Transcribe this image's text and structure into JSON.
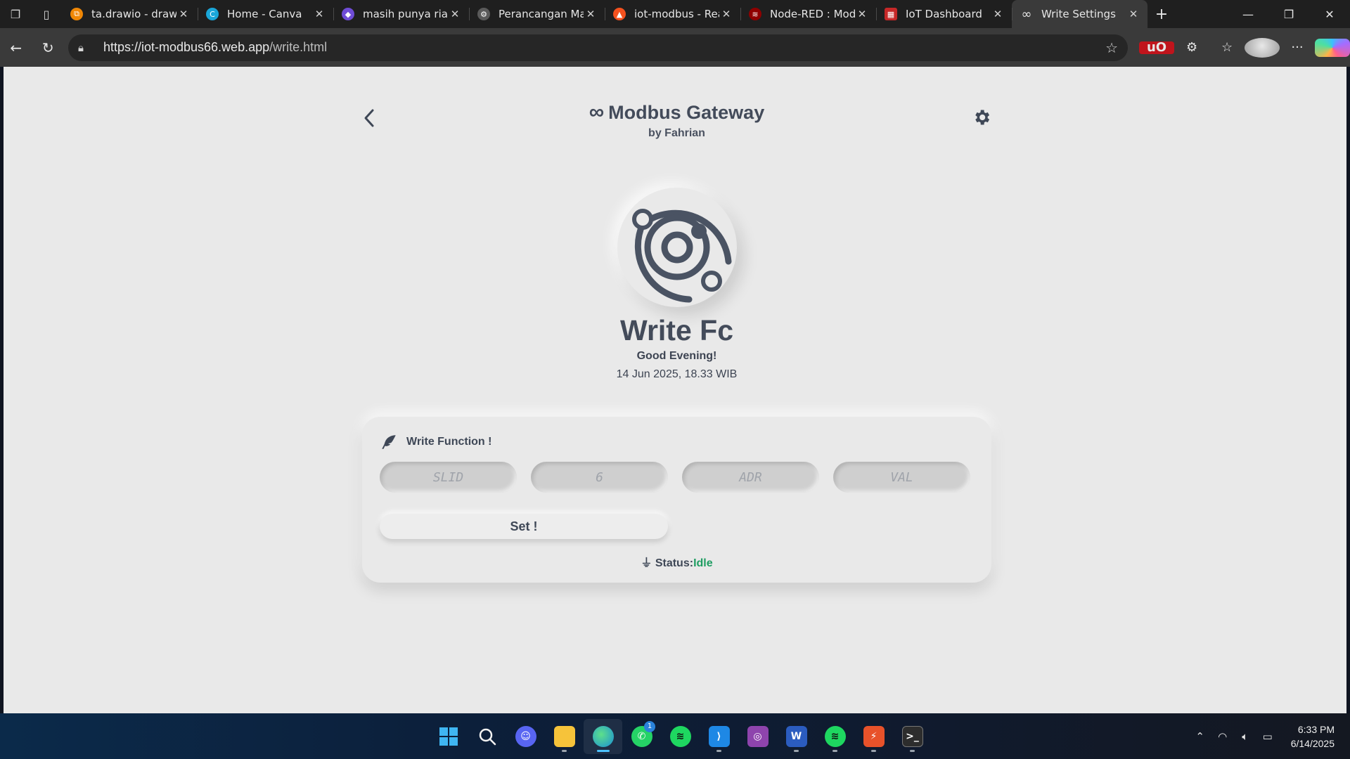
{
  "browser": {
    "tabs": [
      {
        "title": "ta.drawio - draw.io",
        "fav_color": "#f08705",
        "fav_glyph": "⧉"
      },
      {
        "title": "Home - Canva",
        "fav_color": "#1aa6d8",
        "fav_glyph": "C"
      },
      {
        "title": "masih punya rian",
        "fav_color": "#6f4cd6",
        "fav_glyph": "◆"
      },
      {
        "title": "Perancangan Mas",
        "fav_color": "#5a5a5a",
        "fav_glyph": "⚙"
      },
      {
        "title": "iot-modbus - Rea",
        "fav_color": "#f4511e",
        "fav_glyph": "▲"
      },
      {
        "title": "Node-RED : Modb",
        "fav_color": "#8f0000",
        "fav_glyph": "≋"
      },
      {
        "title": "IoT Dashboard",
        "fav_color": "#c62828",
        "fav_glyph": "▦"
      },
      {
        "title": "Write Settings",
        "fav_color": "#3a3a3a",
        "fav_glyph": "∞"
      }
    ],
    "url_host": "https://iot-modbus66.web.app",
    "url_path": "/write.html"
  },
  "page": {
    "brand_title": "Modbus Gateway",
    "brand_sub": "by Fahrian",
    "title": "Write Fc",
    "greeting": "Good Evening!",
    "datetime": "14 Jun 2025, 18.33 WIB",
    "card_title": "Write Function !",
    "fields": {
      "slid_placeholder": "SLID",
      "fc_placeholder": "6",
      "adr_placeholder": "ADR",
      "val_placeholder": "VAL"
    },
    "set_label": "Set !",
    "status_label": "Status:",
    "status_value": "Idle",
    "accent": "#434b5a",
    "status_color": "#1f9d62"
  },
  "taskbar": {
    "apps": [
      "windows-start",
      "search",
      "discord",
      "file-explorer",
      "edge",
      "whatsapp",
      "spotify",
      "vscode",
      "app-purple",
      "word",
      "spotify-2",
      "reader",
      "terminal"
    ],
    "whatsapp_badge": "1",
    "time": "6:33 PM",
    "date": "6/14/2025"
  }
}
